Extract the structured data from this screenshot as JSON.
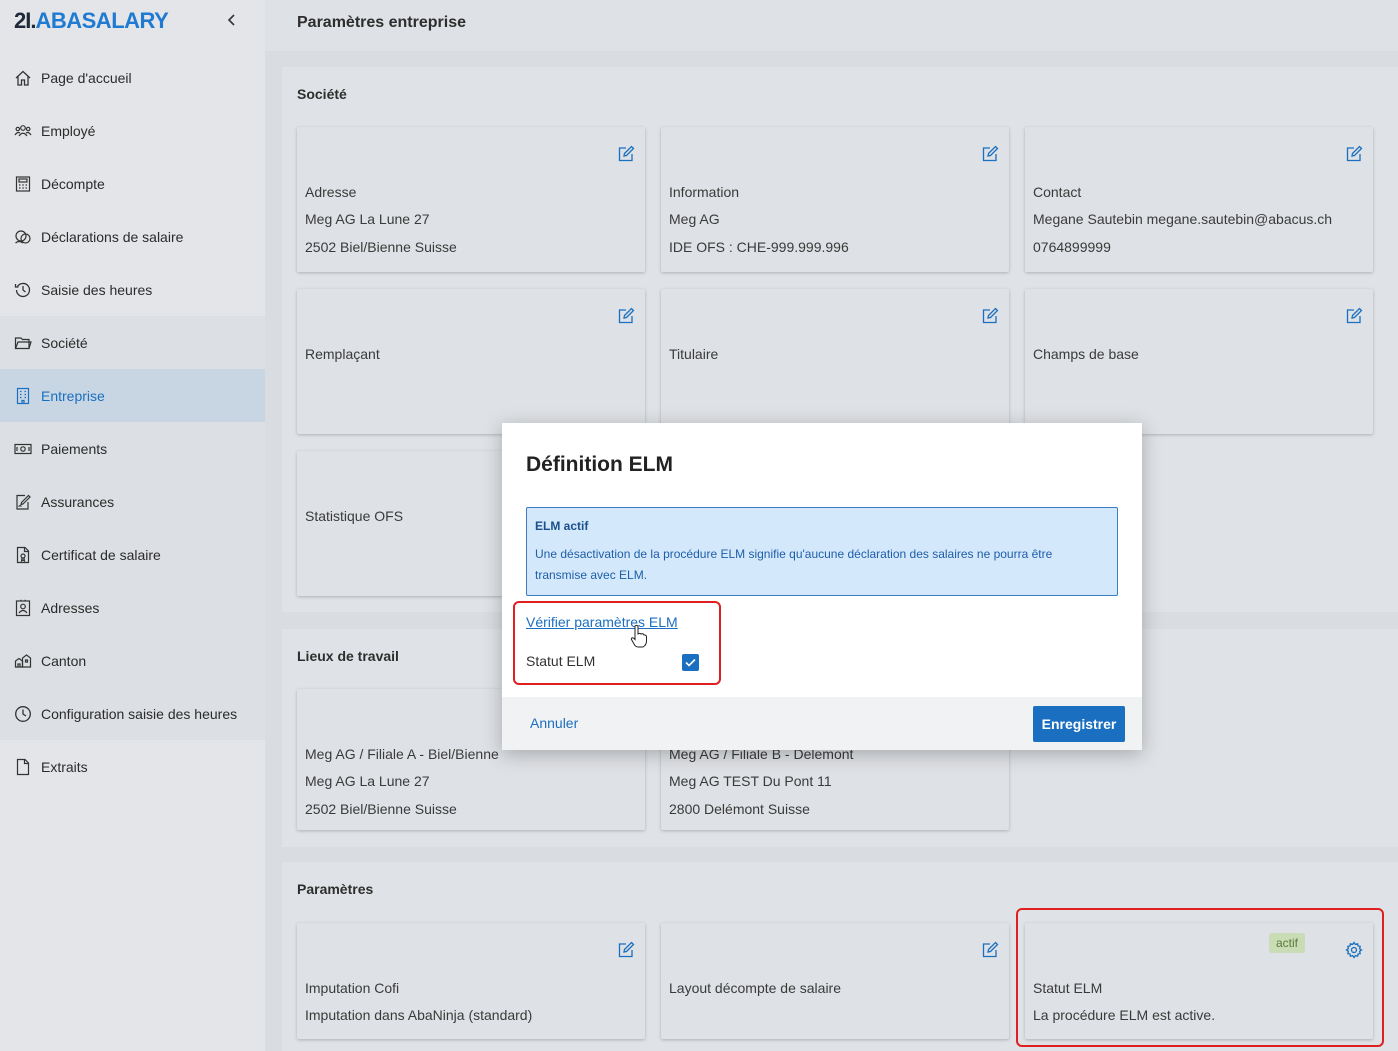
{
  "brand": {
    "prefix": "2I.",
    "name": "ABASALARY"
  },
  "sidebar": {
    "collapse_icon": "chevron-left-icon",
    "items": [
      {
        "label": "Page d'accueil",
        "icon": "home-icon"
      },
      {
        "label": "Employé",
        "icon": "people-icon"
      },
      {
        "label": "Décompte",
        "icon": "calculator-icon"
      },
      {
        "label": "Déclarations de salaire",
        "icon": "coins-icon"
      },
      {
        "label": "Saisie des heures",
        "icon": "history-icon"
      },
      {
        "label": "Société",
        "icon": "folder-icon"
      },
      {
        "label": "Entreprise",
        "icon": "building-icon"
      },
      {
        "label": "Paiements",
        "icon": "banknote-icon"
      },
      {
        "label": "Assurances",
        "icon": "signature-icon"
      },
      {
        "label": "Certificat de salaire",
        "icon": "certificate-icon"
      },
      {
        "label": "Adresses",
        "icon": "contact-icon"
      },
      {
        "label": "Canton",
        "icon": "canton-icon"
      },
      {
        "label": "Configuration saisie des heures",
        "icon": "clock-icon"
      },
      {
        "label": "Extraits",
        "icon": "document-icon"
      }
    ],
    "active": "Entreprise"
  },
  "page": {
    "title": "Paramètres entreprise"
  },
  "societe": {
    "title": "Société",
    "cards": [
      {
        "title": "Adresse",
        "line2": "Meg AG  La Lune 27",
        "line3": "2502 Biel/Bienne  Suisse"
      },
      {
        "title": "Information",
        "line2": "Meg AG",
        "line3": "IDE OFS : CHE-999.999.996"
      },
      {
        "title": "Contact",
        "line2": "Megane Sautebin  megane.sautebin@abacus.ch",
        "line3": "0764899999"
      },
      {
        "title": "Remplaçant"
      },
      {
        "title": "Titulaire"
      },
      {
        "title": "Champs de base"
      },
      {
        "title": "Statistique OFS"
      }
    ]
  },
  "lieux": {
    "title": "Lieux de travail",
    "cards": [
      {
        "title": "Meg AG / Filiale A - Biel/Bienne",
        "line2": "Meg AG  La Lune 27",
        "line3": "2502 Biel/Bienne  Suisse"
      },
      {
        "title": "Meg AG / Filiale B - Delemont",
        "line2": "Meg AG TEST  Du Pont 11",
        "line3": "2800 Delémont  Suisse"
      }
    ]
  },
  "parametres": {
    "title": "Paramètres",
    "cards": [
      {
        "title": "Imputation Cofi",
        "line2": "Imputation dans AbaNinja (standard)"
      },
      {
        "title": "Layout décompte de salaire"
      },
      {
        "title": "Statut ELM",
        "line2": "La procédure ELM est active.",
        "badge": "actif"
      }
    ]
  },
  "modal": {
    "title": "Définition ELM",
    "info_title": "ELM actif",
    "info_text": "Une désactivation de la procédure ELM signifie qu'aucune déclaration des salaires ne pourra être transmise avec ELM.",
    "verify_link": "Vérifier paramètres ELM",
    "statut_label": "Statut ELM",
    "statut_checked": true,
    "cancel": "Annuler",
    "save": "Enregistrer"
  },
  "colors": {
    "accent": "#1a6fc0",
    "highlight": "#e02020",
    "badge_bg": "#c9dcb6"
  }
}
